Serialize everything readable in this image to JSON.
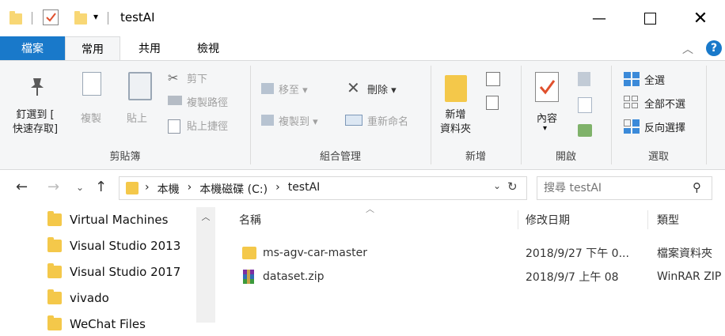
{
  "window": {
    "title": "testAI"
  },
  "tabs": {
    "file": "檔案",
    "home": "常用",
    "share": "共用",
    "view": "檢視"
  },
  "ribbon": {
    "clipboard": {
      "pin_label_1": "釘選到 [",
      "pin_label_2": "快速存取]",
      "copy": "複製",
      "paste": "貼上",
      "cut": "剪下",
      "copy_path": "複製路徑",
      "paste_shortcut": "貼上捷徑",
      "group": "剪貼簿"
    },
    "organize": {
      "move_to": "移至",
      "copy_to": "複製到",
      "delete": "刪除",
      "rename": "重新命名",
      "group": "組合管理"
    },
    "new": {
      "new_folder_1": "新增",
      "new_folder_2": "資料夾",
      "group": "新增"
    },
    "open": {
      "properties": "內容",
      "group": "開啟"
    },
    "select": {
      "select_all": "全選",
      "select_none": "全部不選",
      "invert": "反向選擇",
      "group": "選取"
    }
  },
  "address": {
    "crumbs": [
      "本機",
      "本機磁碟 (C:)",
      "testAI"
    ],
    "search_placeholder": "搜尋 testAI"
  },
  "nav_items": [
    "Virtual Machines",
    "Visual Studio 2013",
    "Visual Studio 2017",
    "vivado",
    "WeChat Files"
  ],
  "columns": {
    "name": "名稱",
    "date": "修改日期",
    "type": "類型"
  },
  "files": [
    {
      "name": "ms-agv-car-master",
      "date": "2018/9/27 下午 0...",
      "type": "檔案資料夾",
      "icon": "folder-icon"
    },
    {
      "name": "dataset.zip",
      "date": "2018/9/7 上午 08",
      "type": "WinRAR ZIP",
      "icon": "winrar-archive-icon"
    }
  ],
  "colors": {
    "accent": "#1979ca",
    "folder": "#f4c84a",
    "help": "#1979ca"
  }
}
